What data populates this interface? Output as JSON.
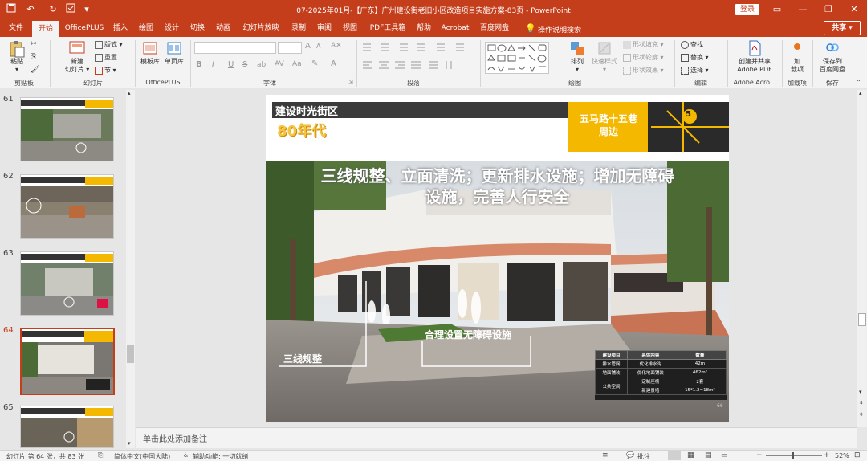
{
  "window": {
    "title": "07-2025年01月-【广东】广州建设街老旧小区改造项目实施方案-83页 - PowerPoint",
    "login": "登录",
    "share": "共享",
    "quick_access": [
      "save-icon",
      "undo-icon",
      "redo-icon",
      "autosave-icon",
      "dropdown-icon"
    ]
  },
  "tabs": [
    "文件",
    "开始",
    "OfficePLUS",
    "插入",
    "绘图",
    "设计",
    "切换",
    "动画",
    "幻灯片放映",
    "录制",
    "审阅",
    "视图",
    "PDF工具箱",
    "帮助",
    "Acrobat",
    "百度网盘"
  ],
  "active_tab": "开始",
  "tell_me": "操作说明搜索",
  "ribbon": {
    "clipboard": {
      "paste": "粘贴",
      "label": "剪贴板"
    },
    "slides": {
      "new_slide": "新建\n幻灯片",
      "layout": "版式",
      "reset": "重置",
      "section": "节",
      "label": "幻灯片"
    },
    "officeplus": {
      "template": "模板库",
      "single": "单页库",
      "label": "OfficePLUS"
    },
    "font": {
      "label": "字体",
      "bold": "B",
      "italic": "I",
      "underline": "U",
      "strike": "S",
      "shadow": "ab"
    },
    "paragraph": {
      "label": "段落"
    },
    "drawing": {
      "arrange": "排列",
      "quick_styles": "快速样式",
      "fill": "形状填充",
      "outline": "形状轮廓",
      "effects": "形状效果",
      "label": "绘图"
    },
    "editing": {
      "find": "查找",
      "replace": "替换",
      "select": "选择",
      "label": "编辑"
    },
    "adobe": {
      "create": "创建并共享\nAdobe PDF",
      "label": "Adobe Acro..."
    },
    "addins": {
      "add": "加\n载项",
      "label": "加载项"
    },
    "save": {
      "save": "保存到\n百度网盘",
      "label": "保存"
    }
  },
  "thumbnails": [
    {
      "num": "61"
    },
    {
      "num": "62"
    },
    {
      "num": "63"
    },
    {
      "num": "64",
      "selected": true
    },
    {
      "num": "65"
    }
  ],
  "slide": {
    "header": "建设时光街区",
    "era": "80年代",
    "location": "五马路十五巷\n周边",
    "map_badge": "5",
    "headline": "三线规整、立面清洗；更新排水设施；增加无障碍\n设施，完善人行安全",
    "callout_left": "三线规整",
    "callout_right": "合理设置无障碍设施",
    "page_num": "66",
    "table": {
      "headers": [
        "建设项目",
        "具体内容",
        "数量"
      ],
      "rows": [
        [
          "排水管网",
          "优化排水沟",
          "42m"
        ],
        [
          "地面铺装",
          "优化地面铺装",
          "462m²"
        ],
        [
          "公共空间",
          "定制座椅",
          "2套"
        ],
        [
          "",
          "新建景墙",
          "15*1.2=18m²"
        ]
      ]
    }
  },
  "notes": "单击此处添加备注",
  "status": {
    "slide_info": "幻灯片 第 64 张，共 83 张",
    "language": "简体中文(中国大陆)",
    "accessibility": "辅助功能: 一切就绪",
    "notes_btn": "批注",
    "zoom": "52%"
  },
  "colors": {
    "brand": "#c43e1c",
    "accent": "#f5b800"
  }
}
